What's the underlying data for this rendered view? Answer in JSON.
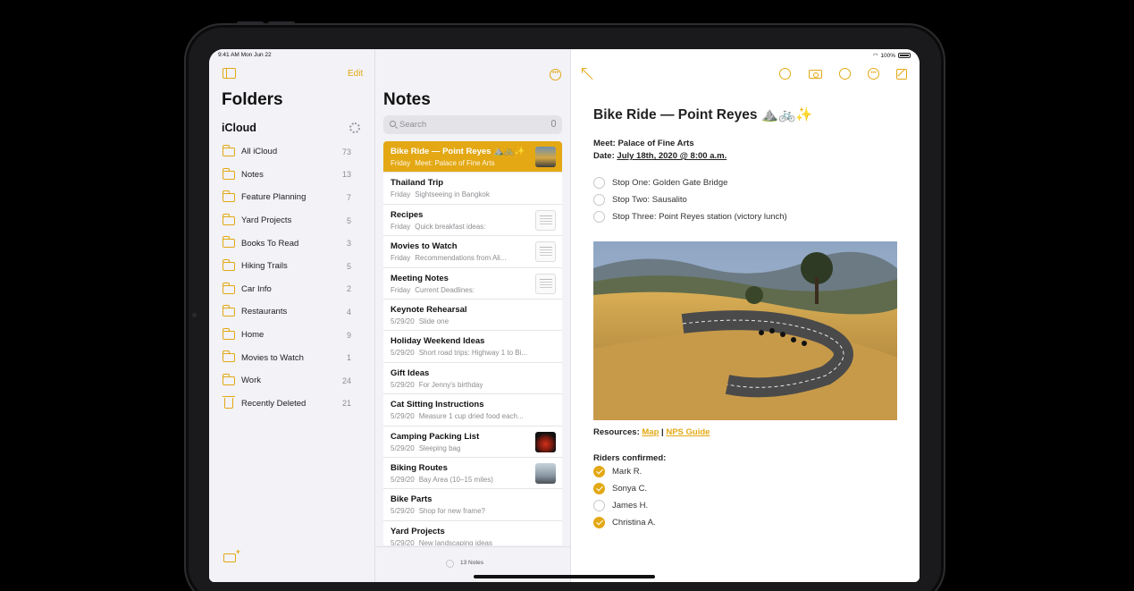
{
  "status_bar": {
    "time": "9:41 AM  Mon Jun 22",
    "battery": "100%"
  },
  "sidebar": {
    "edit_label": "Edit",
    "title": "Folders",
    "account": "iCloud",
    "folders": [
      {
        "name": "All iCloud",
        "count": "73"
      },
      {
        "name": "Notes",
        "count": "13"
      },
      {
        "name": "Feature Planning",
        "count": "7"
      },
      {
        "name": "Yard Projects",
        "count": "5"
      },
      {
        "name": "Books To Read",
        "count": "3"
      },
      {
        "name": "Hiking Trails",
        "count": "5"
      },
      {
        "name": "Car Info",
        "count": "2"
      },
      {
        "name": "Restaurants",
        "count": "4"
      },
      {
        "name": "Home",
        "count": "9"
      },
      {
        "name": "Movies to Watch",
        "count": "1"
      },
      {
        "name": "Work",
        "count": "24"
      },
      {
        "name": "Recently Deleted",
        "count": "21"
      }
    ]
  },
  "notes_list": {
    "title": "Notes",
    "search_placeholder": "Search",
    "footer_count": "13 Notes",
    "notes": [
      {
        "title": "Bike Ride — Point Reyes ⛰️🚲✨",
        "date": "Friday",
        "preview": "Meet: Palace of Fine Arts",
        "thumb": "bike"
      },
      {
        "title": "Thailand Trip",
        "date": "Friday",
        "preview": "Sightseeing in Bangkok",
        "thumb": ""
      },
      {
        "title": "Recipes",
        "date": "Friday",
        "preview": "Quick breakfast ideas:",
        "thumb": "sheet"
      },
      {
        "title": "Movies to Watch",
        "date": "Friday",
        "preview": "Recommendations from Ali...",
        "thumb": "sheet"
      },
      {
        "title": "Meeting Notes",
        "date": "Friday",
        "preview": "Current Deadlines:",
        "thumb": "sheet"
      },
      {
        "title": "Keynote Rehearsal",
        "date": "5/29/20",
        "preview": "Slide one",
        "thumb": ""
      },
      {
        "title": "Holiday Weekend Ideas",
        "date": "5/29/20",
        "preview": "Short road trips: Highway 1 to Bi...",
        "thumb": ""
      },
      {
        "title": "Gift Ideas",
        "date": "5/29/20",
        "preview": "For Jenny's birthday",
        "thumb": ""
      },
      {
        "title": "Cat Sitting Instructions",
        "date": "5/29/20",
        "preview": "Measure 1 cup dried food each...",
        "thumb": ""
      },
      {
        "title": "Camping Packing List",
        "date": "5/29/20",
        "preview": "Sleeping bag",
        "thumb": "camp"
      },
      {
        "title": "Biking Routes",
        "date": "5/29/20",
        "preview": "Bay Area (10–15 miles)",
        "thumb": "biking"
      },
      {
        "title": "Bike Parts",
        "date": "5/29/20",
        "preview": "Shop for new frame?",
        "thumb": ""
      },
      {
        "title": "Yard Projects",
        "date": "5/29/20",
        "preview": "New landscaping ideas",
        "thumb": ""
      }
    ]
  },
  "detail": {
    "title": "Bike Ride — Point Reyes ⛰️🚲✨",
    "meet": "Meet: Palace of Fine Arts",
    "date_label": "Date: ",
    "date_value": "July 18th, 2020 @ 8:00 a.m.",
    "stops": [
      "Stop One: Golden Gate Bridge",
      "Stop Two: Sausalito",
      "Stop Three: Point Reyes station (victory lunch)"
    ],
    "resources_label": "Resources: ",
    "resources_link1": "Map",
    "resources_sep": " | ",
    "resources_link2": "NPS Guide",
    "riders_label": "Riders confirmed:",
    "riders": [
      {
        "name": "Mark R.",
        "checked": true
      },
      {
        "name": "Sonya C.",
        "checked": true
      },
      {
        "name": "James H.",
        "checked": false
      },
      {
        "name": "Christina A.",
        "checked": true
      }
    ]
  },
  "colors": {
    "accent": "#e3a814",
    "sidebar_bg": "#f2f2f7"
  }
}
